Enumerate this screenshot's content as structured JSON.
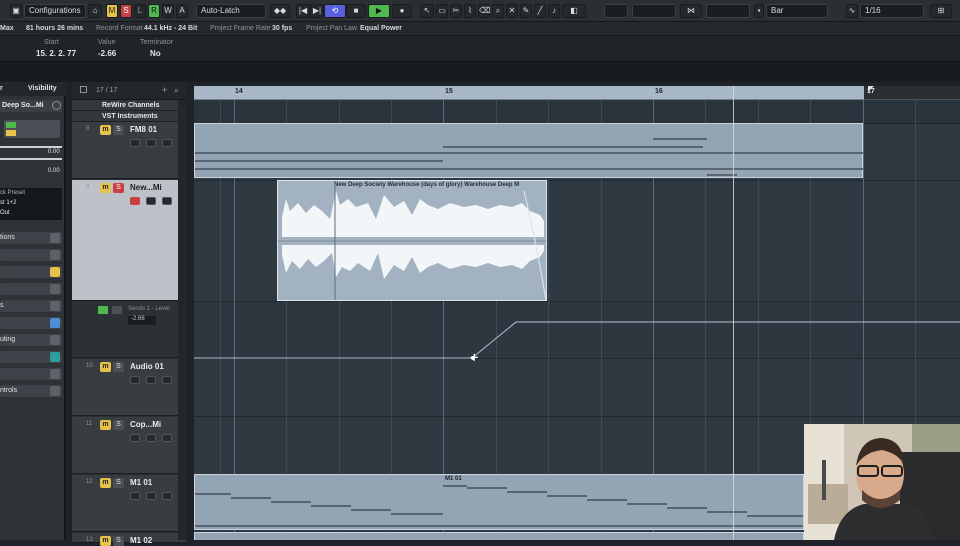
{
  "toolbar": {
    "configurations_label": "Configurations",
    "m_label": "M",
    "s_label": "S",
    "l_label": "L",
    "r_label": "R",
    "w_label": "W",
    "a_label": "A",
    "automation_mode": "Auto-Latch",
    "quantize_mode": "Bar",
    "quantize_value": "1/16"
  },
  "infoline": {
    "max_label": "Max",
    "record_time": "81 hours 26 mins",
    "record_format_label": "Record Format",
    "record_format": "44.1 kHz - 24 Bit",
    "frame_rate_label": "Project Frame Rate",
    "frame_rate": "30 fps",
    "pan_law_label": "Project Pan Law",
    "pan_law": "Equal Power"
  },
  "eventinfo": {
    "start_label": "Start",
    "start_value": "15. 2. 2. 77",
    "value_label": "Value",
    "value_value": "-2.66",
    "terminator_label": "Terminator",
    "terminator_value": "No"
  },
  "inspector": {
    "tab_visibility": "Visibility",
    "tab_left": "r",
    "track_name": "Deep So...Mi",
    "vol_value": "0.00",
    "pan_value": "0.00",
    "preset": "ck Preset",
    "input_routing": "st 1+2",
    "output_routing": "Out",
    "sections": [
      "tions",
      "",
      "",
      "",
      "s",
      "",
      "",
      "uting",
      "",
      "",
      "ntrols"
    ]
  },
  "tracklist": {
    "counter": "17 / 17",
    "folders": [
      "ReWire Channels",
      "VST Instruments"
    ],
    "tracks": [
      {
        "num": "8",
        "name": "FM8 01"
      },
      {
        "num": "9",
        "name": "New...Mi"
      },
      {
        "num": "",
        "name": "Sends 1 - Level",
        "value": "-2.66"
      },
      {
        "num": "10",
        "name": "Audio 01"
      },
      {
        "num": "11",
        "name": "Cop...Mi"
      },
      {
        "num": "12",
        "name": "M1 01"
      },
      {
        "num": "13",
        "name": "M1 02"
      }
    ]
  },
  "ruler": {
    "bars": [
      "14",
      "15",
      "16",
      "17"
    ]
  },
  "events": {
    "audio_event": "New Deep Society Warehouse (days of glory) Warehouse Deep M",
    "midi_part": "M1 01"
  }
}
